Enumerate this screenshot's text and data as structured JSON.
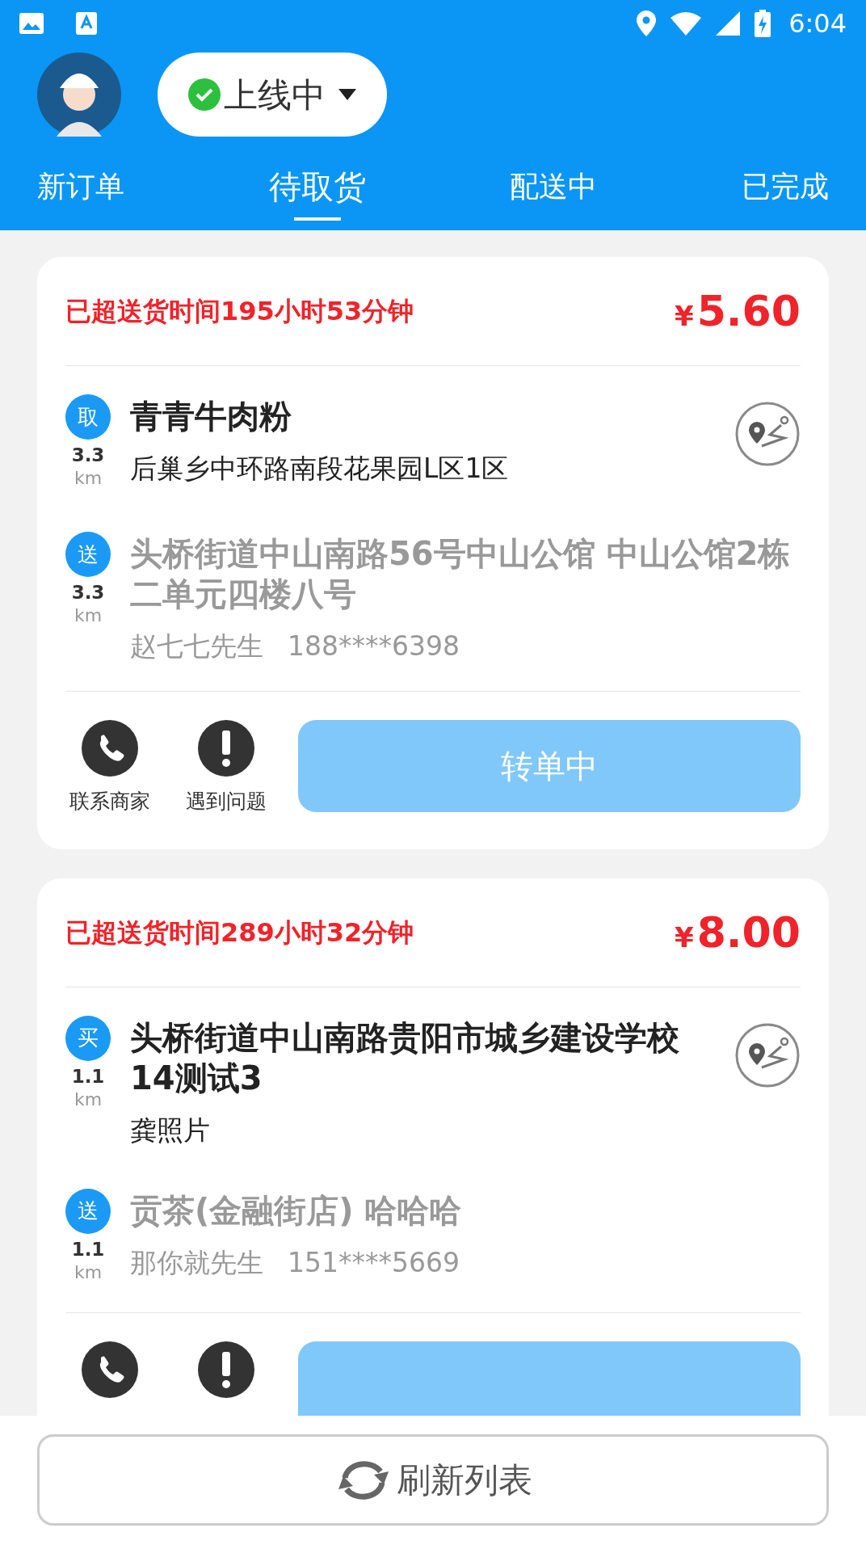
{
  "status_bar": {
    "time": "6:04"
  },
  "header": {
    "status": {
      "label": "上线中",
      "online": true
    }
  },
  "tabs": [
    {
      "label": "新订单",
      "selected": false
    },
    {
      "label": "待取货",
      "selected": true
    },
    {
      "label": "配送中",
      "selected": false
    },
    {
      "label": "已完成",
      "selected": false
    }
  ],
  "orders": [
    {
      "overtime": "已超送货时间195小时53分钟",
      "currency": "¥",
      "price": "5.60",
      "stops": [
        {
          "kind": "pickup",
          "badge": "取",
          "distance": "3.3",
          "unit": "km",
          "title": "青青牛肉粉",
          "subtitle": "后巢乡中环路南段花果园L区1区"
        },
        {
          "kind": "dropoff",
          "badge": "送",
          "distance": "3.3",
          "unit": "km",
          "title": "头桥街道中山南路56号中山公馆 中山公馆2栋二单元四楼八号",
          "contact_name": "赵七七先生",
          "contact_phone": "188****6398"
        }
      ],
      "actions": [
        {
          "kind": "phone",
          "label": "联系商家"
        },
        {
          "kind": "problem",
          "label": "遇到问题"
        }
      ],
      "button": "转单中"
    },
    {
      "overtime": "已超送货时间289小时32分钟",
      "currency": "¥",
      "price": "8.00",
      "stops": [
        {
          "kind": "buy",
          "badge": "买",
          "distance": "1.1",
          "unit": "km",
          "title": "头桥街道中山南路贵阳市城乡建设学校14测试3",
          "subtitle": "龚照片"
        },
        {
          "kind": "dropoff",
          "badge": "送",
          "distance": "1.1",
          "unit": "km",
          "title": "贡茶(金融街店) 哈哈哈",
          "contact_name": "那你就先生",
          "contact_phone": "151****5669"
        }
      ],
      "actions": [
        {
          "kind": "phone"
        },
        {
          "kind": "problem"
        }
      ]
    }
  ],
  "refresh_button": "刷新列表"
}
